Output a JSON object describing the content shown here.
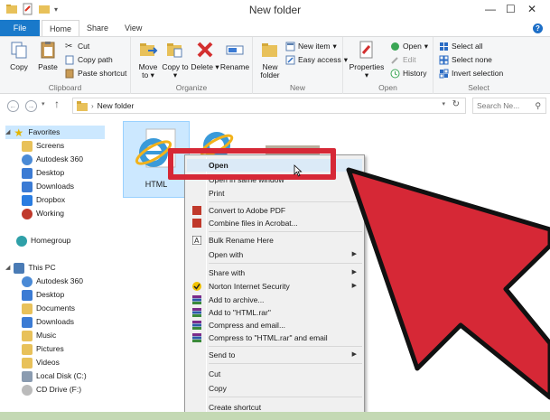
{
  "window": {
    "title": "New folder",
    "min": "—",
    "max": "☐",
    "close": "✕"
  },
  "tabs": [
    {
      "label": "File"
    },
    {
      "label": "Home"
    },
    {
      "label": "Share"
    },
    {
      "label": "View"
    }
  ],
  "help": "?",
  "ribbon": {
    "clipboard": {
      "label": "Clipboard",
      "copy": "Copy",
      "paste": "Paste",
      "cut": "Cut",
      "copy_path": "Copy path",
      "paste_shortcut": "Paste shortcut"
    },
    "organize": {
      "label": "Organize",
      "move_to": "Move to",
      "copy_to": "Copy to",
      "delete": "Delete",
      "rename": "Rename"
    },
    "new": {
      "label": "New",
      "new_folder": "New folder",
      "new_item": "New item",
      "easy_access": "Easy access"
    },
    "open": {
      "label": "Open",
      "properties": "Properties",
      "open": "Open",
      "edit": "Edit",
      "history": "History"
    },
    "select": {
      "label": "Select",
      "select_all": "Select all",
      "select_none": "Select none",
      "invert_selection": "Invert selection"
    }
  },
  "address": {
    "path": "New folder",
    "search_placeholder": "Search Ne..."
  },
  "nav": {
    "favorites": {
      "label": "Favorites",
      "items": [
        "Screens",
        "Autodesk 360",
        "Desktop",
        "Downloads",
        "Dropbox",
        "Working"
      ]
    },
    "homegroup": "Homegroup",
    "thispc": {
      "label": "This PC",
      "items": [
        "Autodesk 360",
        "Desktop",
        "Documents",
        "Downloads",
        "Music",
        "Pictures",
        "Videos",
        "Local Disk (C:)",
        "CD Drive (F:)"
      ]
    }
  },
  "files": [
    {
      "name": "HTML"
    }
  ],
  "context_menu": {
    "items": [
      {
        "label": "Open",
        "bold": true
      },
      {
        "label": "Open in same window"
      },
      {
        "label": "Print"
      },
      {
        "label": "Convert to Adobe PDF"
      },
      {
        "label": "Combine files in Acrobat..."
      },
      {
        "label": "Bulk Rename Here"
      },
      {
        "label": "Open with"
      },
      {
        "label": "Share with"
      },
      {
        "label": "Norton Internet Security"
      },
      {
        "label": "Add to archive..."
      },
      {
        "label": "Add to \"HTML.rar\""
      },
      {
        "label": "Compress and email..."
      },
      {
        "label": "Compress to \"HTML.rar\" and email"
      },
      {
        "label": "Send to"
      },
      {
        "label": "Cut"
      },
      {
        "label": "Copy"
      },
      {
        "label": "Create shortcut"
      }
    ]
  },
  "colors": {
    "accent": "#1979ca",
    "highlight": "#d62836",
    "selection": "#cce8ff"
  }
}
